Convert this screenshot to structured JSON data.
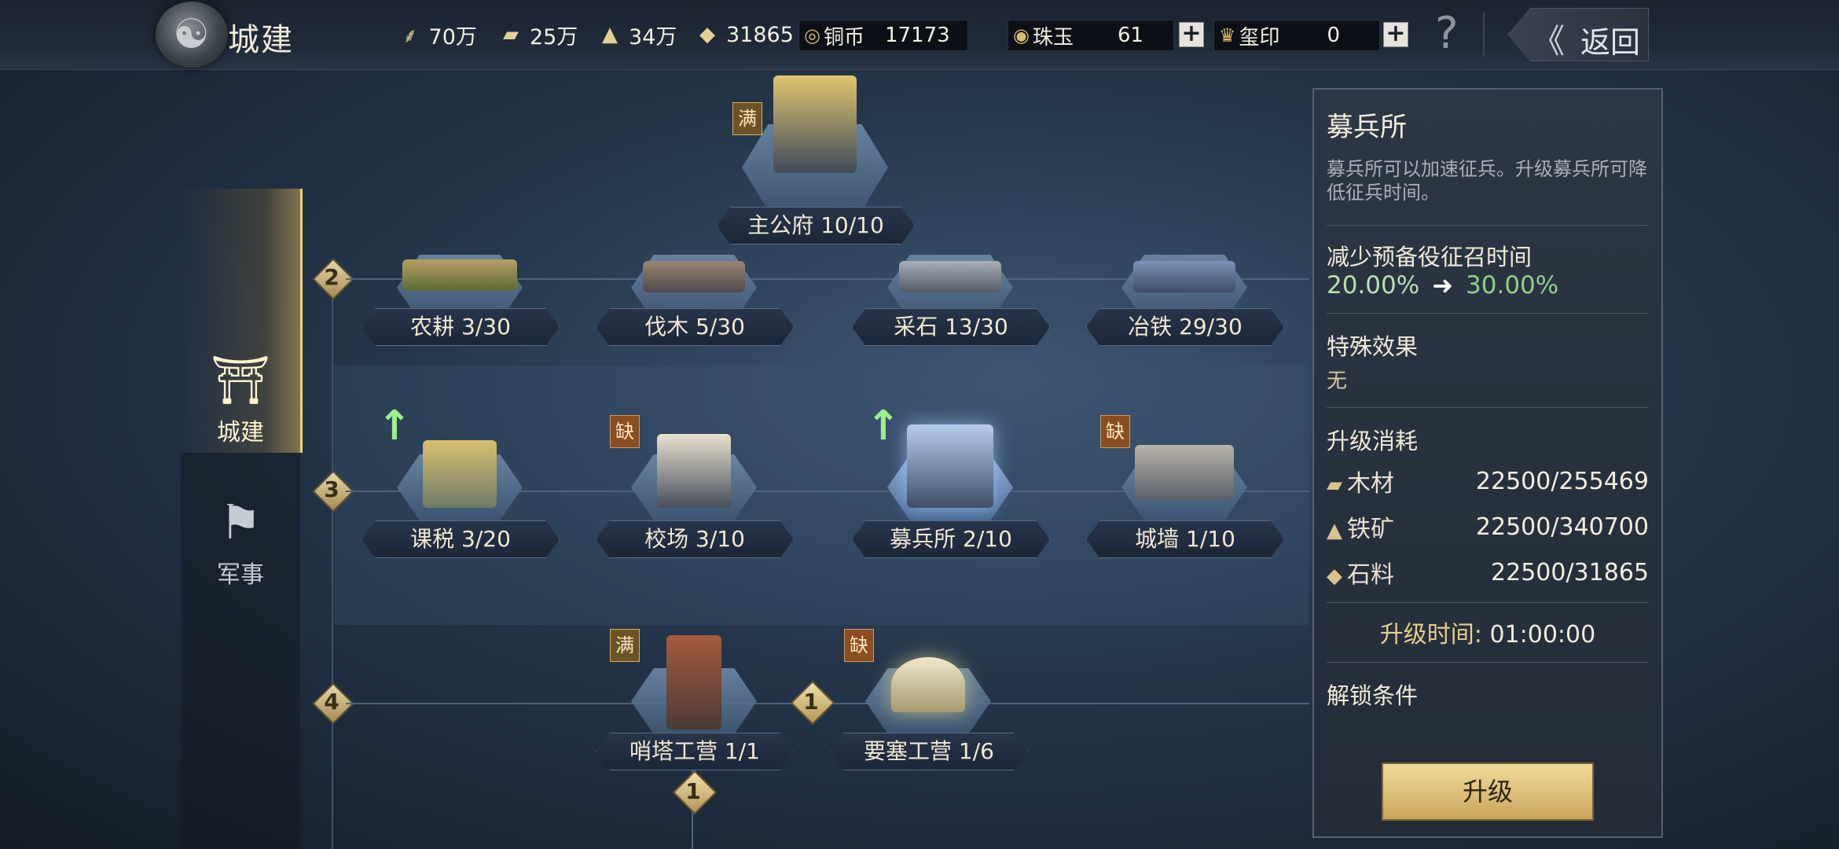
{
  "header": {
    "title": "城建",
    "resources": [
      {
        "icon": "grain-icon",
        "value": "70万"
      },
      {
        "icon": "wood-icon",
        "value": "25万"
      },
      {
        "icon": "iron-icon",
        "value": "34万"
      },
      {
        "icon": "stone-icon",
        "value": "31865"
      }
    ],
    "currencies": [
      {
        "icon": "copper-coin-icon",
        "label": "铜币",
        "value": "17173"
      },
      {
        "icon": "jade-icon",
        "label": "珠玉",
        "value": "61"
      },
      {
        "icon": "seal-icon",
        "label": "玺印",
        "value": "0"
      }
    ],
    "plus_glyph": "+",
    "help_glyph": "?",
    "back_label": "返回"
  },
  "nav": {
    "items": [
      {
        "label": "城建",
        "icon": "city-gate-icon",
        "active": true
      },
      {
        "label": "军事",
        "icon": "war-flag-icon",
        "active": false
      }
    ]
  },
  "tree": {
    "tiers": [
      "2",
      "3",
      "4"
    ],
    "main": {
      "name": "主公府 10/10",
      "tag": "满"
    },
    "tier2": [
      {
        "name": "农耕 3/30"
      },
      {
        "name": "伐木 5/30"
      },
      {
        "name": "采石 13/30"
      },
      {
        "name": "冶铁 29/30"
      }
    ],
    "tier3": [
      {
        "name": "课税 3/20",
        "upgradable": true
      },
      {
        "name": "校场 3/10",
        "tag": "缺"
      },
      {
        "name": "募兵所 2/10",
        "upgradable": true,
        "selected": true
      },
      {
        "name": "城墙 1/10",
        "tag": "缺"
      }
    ],
    "tier4": [
      {
        "name": "哨塔工营 1/1",
        "tag": "满"
      },
      {
        "name": "要塞工营 1/6",
        "tag": "缺"
      }
    ],
    "requirement_levels": [
      "1",
      "1"
    ]
  },
  "panel": {
    "title": "募兵所",
    "description": "募兵所可以加速征兵。升级募兵所可降低征兵时间。",
    "effect_label": "减少预备役征召时间",
    "effect_from": "20.00%",
    "effect_to": "30.00%",
    "special_label": "特殊效果",
    "special_value": "无",
    "cost_label": "升级消耗",
    "costs": [
      {
        "icon": "wood-icon",
        "name": "木材",
        "value": "22500/255469"
      },
      {
        "icon": "iron-icon",
        "name": "铁矿",
        "value": "22500/340700"
      },
      {
        "icon": "stone-icon",
        "name": "石料",
        "value": "22500/31865"
      }
    ],
    "time_label": "升级时间:",
    "time_value": "01:00:00",
    "unlock_label": "解锁条件",
    "upgrade_label": "升级"
  },
  "colors": {
    "accent_gold": "#f0cf7a",
    "effect_green": "#8fcf8b",
    "shortage_tag": "#8a4e22",
    "upgrade_arrow": "#9bf08b"
  }
}
